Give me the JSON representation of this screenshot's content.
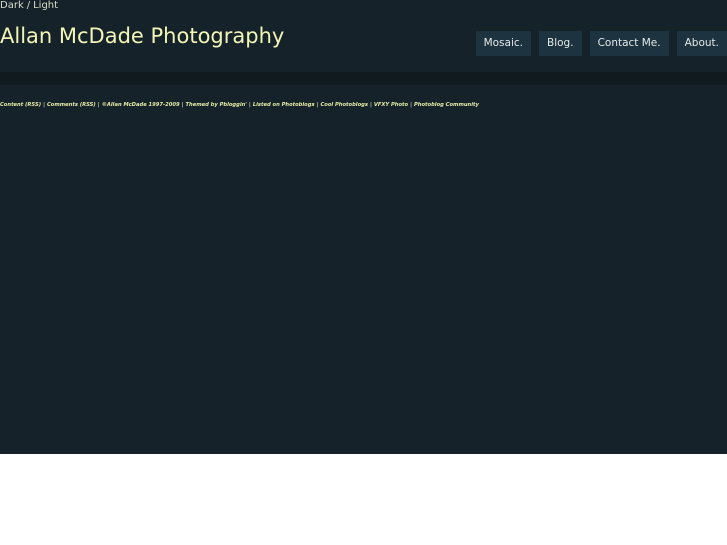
{
  "theme_switch": {
    "dark_label": "Dark",
    "separator": "/",
    "light_label": "Light"
  },
  "site": {
    "title": "Allan McDade Photography"
  },
  "nav": {
    "items": [
      {
        "label": "Mosaic."
      },
      {
        "label": "Blog."
      },
      {
        "label": "Contact Me."
      },
      {
        "label": "About."
      }
    ]
  },
  "footer": {
    "separator": "|",
    "content_rss": "Content (RSS)",
    "comments_rss": "Comments (RSS)",
    "copyright": "©Allan McDade 1997-2009",
    "themed_by_text": "Themed by",
    "themed_by_link": "Pbloggin'",
    "listed_on": "Listed on Photoblogs",
    "cool_photoblogs": "Cool Photoblogs",
    "vfxy_photo": "VFXY Photo",
    "photoblog_community": "Photoblog Community"
  },
  "colors": {
    "background": "#16222a",
    "title": "#f1f5b6",
    "nav_button": "#1d3340",
    "footer_text": "#e7eba6"
  }
}
